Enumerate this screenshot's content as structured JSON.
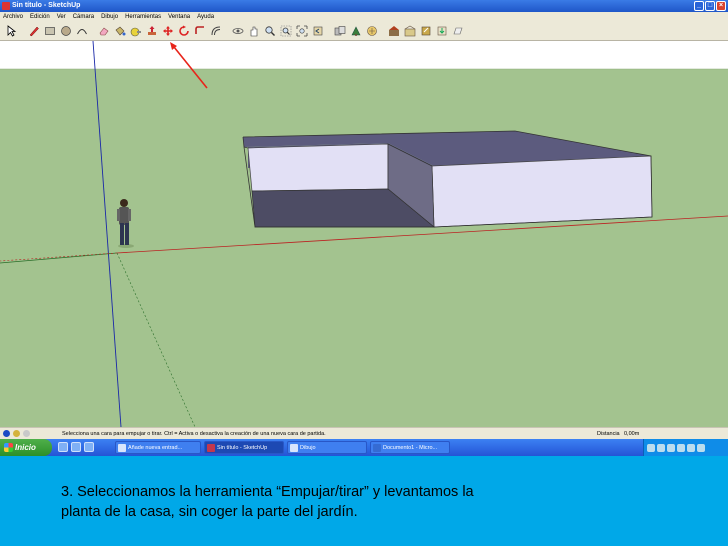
{
  "window": {
    "title": "Sin título - SketchUp",
    "controls": [
      "_",
      "□",
      "×"
    ]
  },
  "menu": [
    "Archivo",
    "Edición",
    "Ver",
    "Cámara",
    "Dibujo",
    "Herramientas",
    "Ventana",
    "Ayuda"
  ],
  "toolbar": {
    "icons": [
      "select-arrow-icon",
      "pencil-icon",
      "rectangle-icon",
      "circle-icon",
      "arc-icon",
      "eraser-icon",
      "paint-bucket-icon",
      "tape-measure-icon",
      "push-pull-icon",
      "move-icon",
      "rotate-icon",
      "follow-me-icon",
      "offset-icon",
      "orbit-icon",
      "pan-icon",
      "zoom-icon",
      "zoom-window-icon",
      "zoom-extents-icon",
      "previous-view-icon",
      "next-view-icon",
      "section-plane-icon",
      "components-icon",
      "materials-icon",
      "3d-warehouse-icon",
      "share-model-icon",
      "get-models-icon",
      "google-earth-icon"
    ]
  },
  "status": {
    "hint": "Selecciona una cara para empujar o tirar.   Ctrl = Activa o desactiva la creación de una nueva cara de partida.",
    "distance_label": "Distancia",
    "distance_value": "0,00m"
  },
  "taskbar": {
    "start_label": "Inicio",
    "tasks": [
      {
        "label": "Añade nueva entrad..."
      },
      {
        "label": "Sin título - SketchUp"
      },
      {
        "label": "Dibujo"
      },
      {
        "label": "Documento1 - Micro..."
      }
    ]
  },
  "caption": {
    "line1": "3.  Seleccionamos la herramienta “Empujar/tirar” y levantamos la",
    "line2": "planta de la casa, sin coger la parte del jardín."
  },
  "colors": {
    "ground": "#a3c38f",
    "sky": "#ffffff",
    "caption_background": "#00a8e8",
    "annotation_arrow": "#e8241a"
  }
}
